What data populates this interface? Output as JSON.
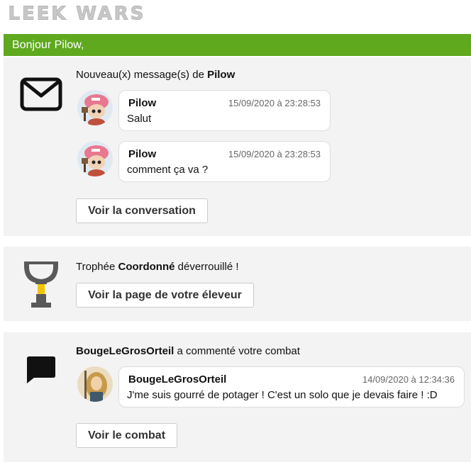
{
  "logo": {
    "text": "LEEK WARS"
  },
  "header": {
    "greeting": "Bonjour Pilow,"
  },
  "messages_card": {
    "title_prefix": "Nouveau(x) message(s) de ",
    "title_name": "Pilow",
    "messages": [
      {
        "author": "Pilow",
        "date": "15/09/2020 à 23:28:53",
        "text": "Salut"
      },
      {
        "author": "Pilow",
        "date": "15/09/2020 à 23:28:53",
        "text": "comment ça va ?"
      }
    ],
    "button": "Voir la conversation"
  },
  "trophy_card": {
    "title_prefix": "Trophée ",
    "title_name": "Coordonné",
    "title_suffix": " déverrouillé !",
    "button": "Voir la page de votre éleveur"
  },
  "comment_card": {
    "title_name": "BougeLeGrosOrteil",
    "title_suffix": " a commenté votre combat",
    "comment": {
      "author": "BougeLeGrosOrteil",
      "date": "14/09/2020 à 12:34:36",
      "text": "J'me suis gourré de potager ! C'est un solo que je devais faire ! :D"
    },
    "button": "Voir le combat"
  },
  "colors": {
    "header_green": "#5fa91f",
    "card_bg": "#f3f3f3",
    "trophy_yellow": "#f5c400"
  },
  "icons": [
    "envelope-icon",
    "trophy-icon",
    "comment-icon"
  ]
}
